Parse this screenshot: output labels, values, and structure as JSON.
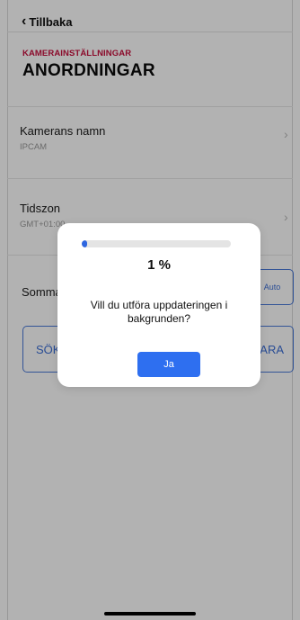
{
  "nav": {
    "back_label": "Tillbaka"
  },
  "header": {
    "kicker": "KAMERAINSTÄLLNINGAR",
    "title": "ANORDNINGAR"
  },
  "settings": {
    "camera_name": {
      "label": "Kamerans namn",
      "value": "IPCAM"
    },
    "timezone": {
      "label": "Tidszon",
      "value": "GMT+01:00"
    },
    "summer_time": {
      "label": "Sommartid",
      "auto_label": "Auto"
    }
  },
  "buttons": {
    "left_label": "SÖK",
    "right_label": "SPARA"
  },
  "dialog": {
    "progress_percent": 1,
    "percent_text": "1 %",
    "message": "Vill du utföra uppdateringen i bakgrunden?",
    "confirm_label": "Ja"
  },
  "colors": {
    "accent": "#2e6ff0",
    "kicker": "#c8103e"
  },
  "icons": {
    "back": "chevron-left-icon",
    "row": "chevron-right-icon"
  }
}
